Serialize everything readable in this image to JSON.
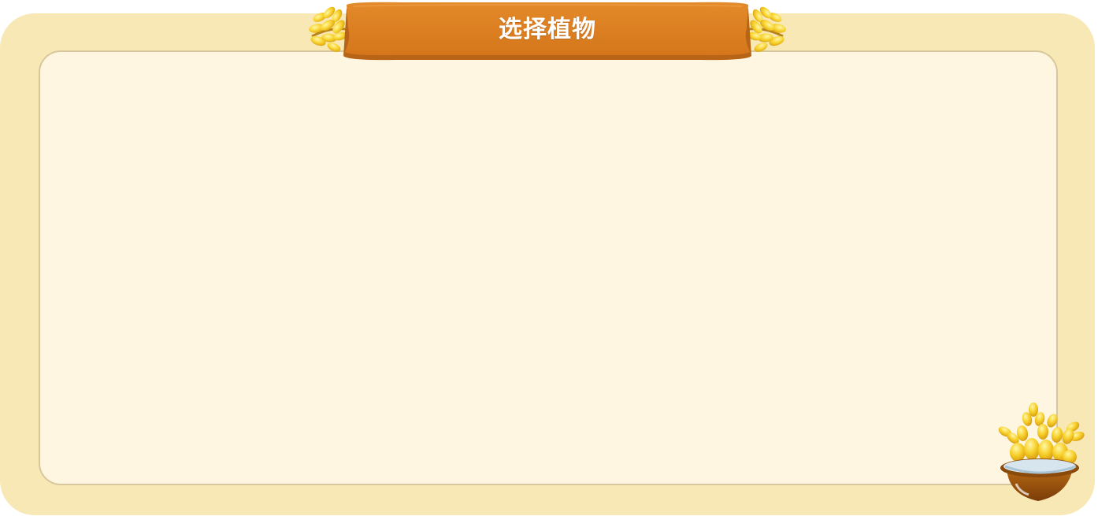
{
  "dialog": {
    "title": "选择植物",
    "banner_color": "#dc7e20",
    "outer_color": "#f8e8b5",
    "inner_color": "#fef6e0"
  },
  "decorations": {
    "left_icon": "wheat-icon",
    "right_icon": "wheat-icon",
    "corner_icon": "wheat-pot-icon"
  }
}
